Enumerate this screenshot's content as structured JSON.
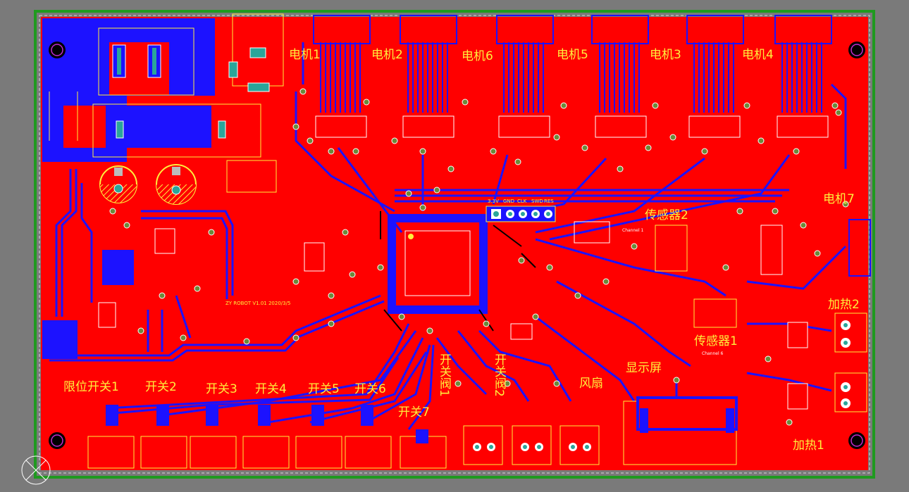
{
  "board": {
    "colors": {
      "background": "#7a7a7a",
      "top_copper": "#ff0000",
      "bottom_copper": "#1c12ff",
      "silkscreen": "#ffef3c",
      "board_outline": "#1f9a1f"
    },
    "header_pins": [
      "3.3V",
      "GND",
      "CLK",
      "SWD",
      "RES"
    ],
    "version_text": "ZY ROBOT V1.01 2020/3/5",
    "channel_labels": [
      "Channel 1",
      "Channel 6"
    ],
    "labels": {
      "motor1": "电机1",
      "motor2": "电机2",
      "motor6": "电机6",
      "motor5": "电机5",
      "motor3": "电机3",
      "motor4": "电机4",
      "motor7": "电机7",
      "sensor2": "传感器2",
      "sensor1": "传感器1",
      "heat2": "加热2",
      "heat1": "加热1",
      "limit1": "限位开关1",
      "switch2": "开关2",
      "switch3": "开关3",
      "switch4": "开关4",
      "switch5": "开关5",
      "switch6": "开关6",
      "switch7": "开关7",
      "valve1": "开关阀1",
      "valve2": "开关阀2",
      "fan": "风扇",
      "display": "显示屏"
    },
    "icons": [
      "mounting-hole-icon",
      "origin-marker-icon"
    ]
  }
}
